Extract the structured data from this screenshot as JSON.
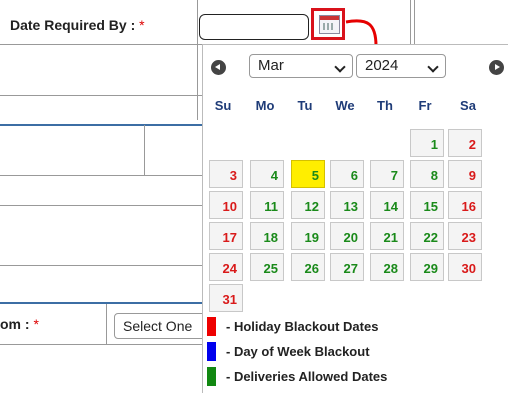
{
  "form": {
    "date_label": "Date Required By :",
    "required_mark": "*",
    "date_value": "",
    "from_label": "om :",
    "select_value": "Select One"
  },
  "calendar": {
    "month": "Mar",
    "year": "2024",
    "weekdays": [
      "Su",
      "Mo",
      "Tu",
      "We",
      "Th",
      "Fr",
      "Sa"
    ],
    "weeks": [
      [
        null,
        null,
        null,
        null,
        null,
        "1",
        "2"
      ],
      [
        "3",
        "4",
        "5",
        "6",
        "7",
        "8",
        "9"
      ],
      [
        "10",
        "11",
        "12",
        "13",
        "14",
        "15",
        "16"
      ],
      [
        "17",
        "18",
        "19",
        "20",
        "21",
        "22",
        "23"
      ],
      [
        "24",
        "25",
        "26",
        "27",
        "28",
        "29",
        "30"
      ],
      [
        "31",
        null,
        null,
        null,
        null,
        null,
        null
      ]
    ],
    "today": "5",
    "colors": {
      "holiday": "#d91a1a",
      "day_of_week": "#1a1ad9",
      "allowed": "#1a8a1a",
      "today": "#ffee00"
    }
  },
  "legend": [
    {
      "label": "- Holiday Blackout Dates",
      "color": "#ee0000"
    },
    {
      "label": "- Day of Week Blackout",
      "color": "#0000ee"
    },
    {
      "label": "- Deliveries Allowed Dates",
      "color": "#118811"
    }
  ],
  "icons": {
    "calendar_button": "calendar-icon",
    "prev": "prev-month-icon",
    "next": "next-month-icon",
    "arrow": "red-curved-arrow-icon"
  }
}
